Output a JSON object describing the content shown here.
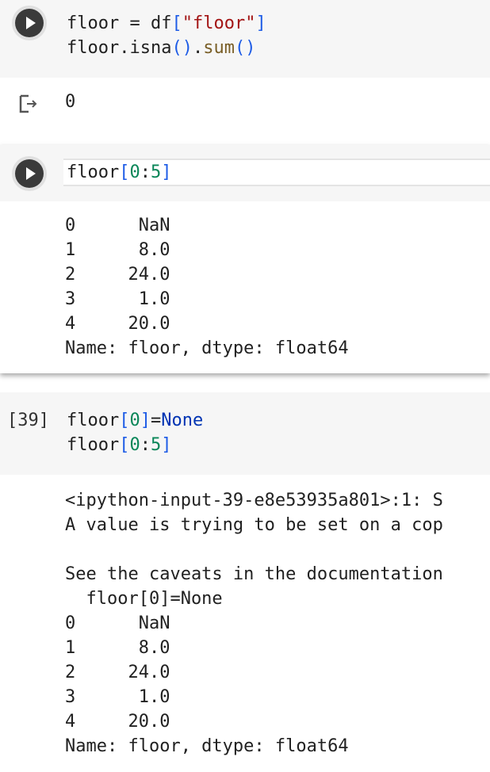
{
  "cells": [
    {
      "code_lines": [
        [
          {
            "t": "floor",
            "c": "var"
          },
          {
            "t": " = ",
            "c": "var"
          },
          {
            "t": "df",
            "c": "var"
          },
          {
            "t": "[",
            "c": "brk"
          },
          {
            "t": "\"floor\"",
            "c": "str"
          },
          {
            "t": "]",
            "c": "brk"
          }
        ],
        [
          {
            "t": "floor",
            "c": "var"
          },
          {
            "t": ".",
            "c": "var"
          },
          {
            "t": "isna",
            "c": "var"
          },
          {
            "t": "()",
            "c": "brk"
          },
          {
            "t": ".",
            "c": "var"
          },
          {
            "t": "sum",
            "c": "fn"
          },
          {
            "t": "()",
            "c": "brk"
          }
        ]
      ],
      "output_lines": [
        "0"
      ]
    },
    {
      "code_lines": [
        [
          {
            "t": "floor",
            "c": "var"
          },
          {
            "t": "[",
            "c": "brk"
          },
          {
            "t": "0",
            "c": "num"
          },
          {
            "t": ":",
            "c": "var"
          },
          {
            "t": "5",
            "c": "num"
          },
          {
            "t": "]",
            "c": "brk"
          }
        ]
      ],
      "output_lines": [
        "0      NaN",
        "1      8.0",
        "2     24.0",
        "3      1.0",
        "4     20.0",
        "Name: floor, dtype: float64"
      ]
    },
    {
      "exec_count": "[39]",
      "code_lines": [
        [
          {
            "t": "floor",
            "c": "var"
          },
          {
            "t": "[",
            "c": "brk"
          },
          {
            "t": "0",
            "c": "num"
          },
          {
            "t": "]",
            "c": "brk"
          },
          {
            "t": "=",
            "c": "var"
          },
          {
            "t": "None",
            "c": "kw"
          }
        ],
        [
          {
            "t": "floor",
            "c": "var"
          },
          {
            "t": "[",
            "c": "brk"
          },
          {
            "t": "0",
            "c": "num"
          },
          {
            "t": ":",
            "c": "var"
          },
          {
            "t": "5",
            "c": "num"
          },
          {
            "t": "]",
            "c": "brk"
          }
        ]
      ],
      "output_lines": [
        "<ipython-input-39-e8e53935a801>:1: S",
        "A value is trying to be set on a cop",
        "",
        "See the caveats in the documentation",
        "  floor[0]=None",
        "0      NaN",
        "1      8.0",
        "2     24.0",
        "3      1.0",
        "4     20.0",
        "Name: floor, dtype: float64"
      ]
    }
  ],
  "icons": {
    "run": "play-circle-icon",
    "output": "output-arrow-icon"
  }
}
